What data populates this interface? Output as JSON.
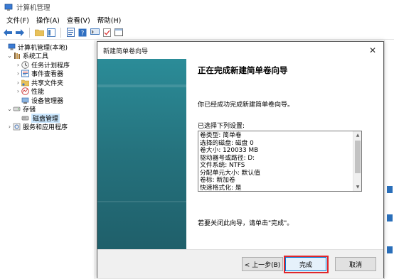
{
  "window": {
    "title": "计算机管理",
    "icon": "computer-management-icon"
  },
  "menubar": {
    "items": [
      "文件(F)",
      "操作(A)",
      "查看(V)",
      "帮助(H)"
    ]
  },
  "toolbar": {
    "icons": [
      "back-arrow-icon",
      "forward-arrow-icon",
      "folder-up-icon",
      "show-tree-icon",
      "properties-icon",
      "help-icon",
      "console-icon",
      "check-icon",
      "panel-icon"
    ]
  },
  "tree": {
    "items": [
      {
        "label": "计算机管理(本地)",
        "level": 0,
        "arrow": "",
        "icon": "computer-management-icon"
      },
      {
        "label": "系统工具",
        "level": 1,
        "arrow": "⌄",
        "icon": "tools-icon"
      },
      {
        "label": "任务计划程序",
        "level": 2,
        "arrow": "›",
        "icon": "clock-icon"
      },
      {
        "label": "事件查看器",
        "level": 2,
        "arrow": "›",
        "icon": "event-viewer-icon"
      },
      {
        "label": "共享文件夹",
        "level": 2,
        "arrow": "›",
        "icon": "shared-folder-icon"
      },
      {
        "label": "性能",
        "level": 2,
        "arrow": "›",
        "icon": "performance-icon"
      },
      {
        "label": "设备管理器",
        "level": 2,
        "arrow": "",
        "icon": "device-manager-icon"
      },
      {
        "label": "存储",
        "level": 1,
        "arrow": "⌄",
        "icon": "storage-icon"
      },
      {
        "label": "磁盘管理",
        "level": 2,
        "arrow": "",
        "icon": "disk-icon",
        "selected": true
      },
      {
        "label": "服务和应用程序",
        "level": 1,
        "arrow": "›",
        "icon": "services-icon"
      }
    ]
  },
  "dialog": {
    "title": "新建简单卷向导",
    "heading": "正在完成新建简单卷向导",
    "intro": "你已经成功完成新建简单卷向导。",
    "list_label": "已选择下列设置:",
    "settings": [
      "卷类型: 简单卷",
      "选择的磁盘: 磁盘 0",
      "卷大小: 120033 MB",
      "驱动器号或路径: D:",
      "文件系统: NTFS",
      "分配单元大小: 默认值",
      "卷标: 新加卷",
      "快速格式化: 是"
    ],
    "closing": "若要关闭此向导，请单击\"完成\"。",
    "buttons": {
      "back": "< 上一步(B)",
      "finish": "完成",
      "cancel": "取消"
    },
    "banner_color": "#2b8c98",
    "highlight_color": "#e0262b"
  }
}
